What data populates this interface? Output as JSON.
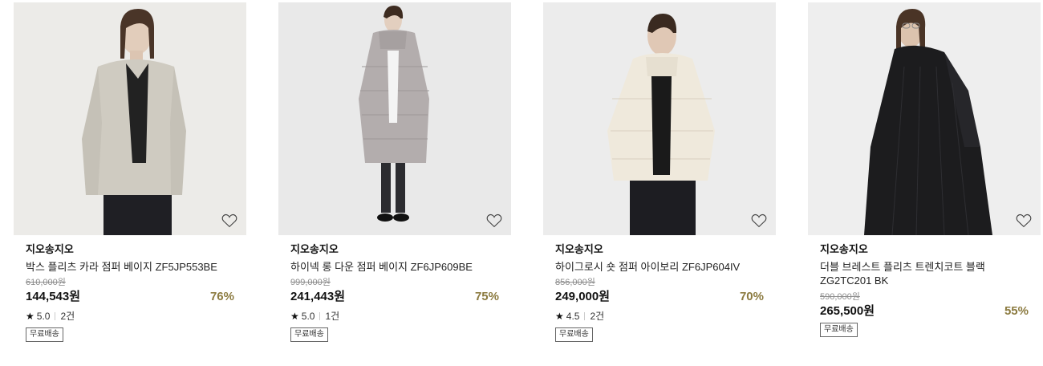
{
  "products": [
    {
      "brand": "지오송지오",
      "name": "박스 플리츠 카라 점퍼 베이지 ZF5JP553BE",
      "original_price": "610,000원",
      "price": "144,543원",
      "discount": "76%",
      "rating": "5.0",
      "review_count": "2건",
      "shipping_badge": "무료배송",
      "garment_color": "#cfcbc1",
      "bg_color": "#ececea"
    },
    {
      "brand": "지오송지오",
      "name": "하이넥 롱 다운 점퍼 베이지 ZF6JP609BE",
      "original_price": "999,000원",
      "price": "241,443원",
      "discount": "75%",
      "rating": "5.0",
      "review_count": "1건",
      "shipping_badge": "무료배송",
      "garment_color": "#b3adad",
      "bg_color": "#e9e9e9"
    },
    {
      "brand": "지오송지오",
      "name": "하이그로시 숏 점퍼 아이보리 ZF6JP604IV",
      "original_price": "856,000원",
      "price": "249,000원",
      "discount": "70%",
      "rating": "4.5",
      "review_count": "2건",
      "shipping_badge": "무료배송",
      "garment_color": "#efe9dc",
      "bg_color": "#ececec"
    },
    {
      "brand": "지오송지오",
      "name": "더블 브레스트 플리츠 트렌치코트 블랙 ZG2TC201 BK",
      "original_price": "590,000원",
      "price": "265,500원",
      "discount": "55%",
      "shipping_badge": "무료배송",
      "garment_color": "#1c1c1e",
      "bg_color": "#eeeeee"
    }
  ],
  "colors": {
    "discount": "#8b7a3f",
    "original_price": "#8c8c8c"
  },
  "icons": {
    "wishlist": "heart-outline-icon",
    "rating": "star-icon"
  }
}
